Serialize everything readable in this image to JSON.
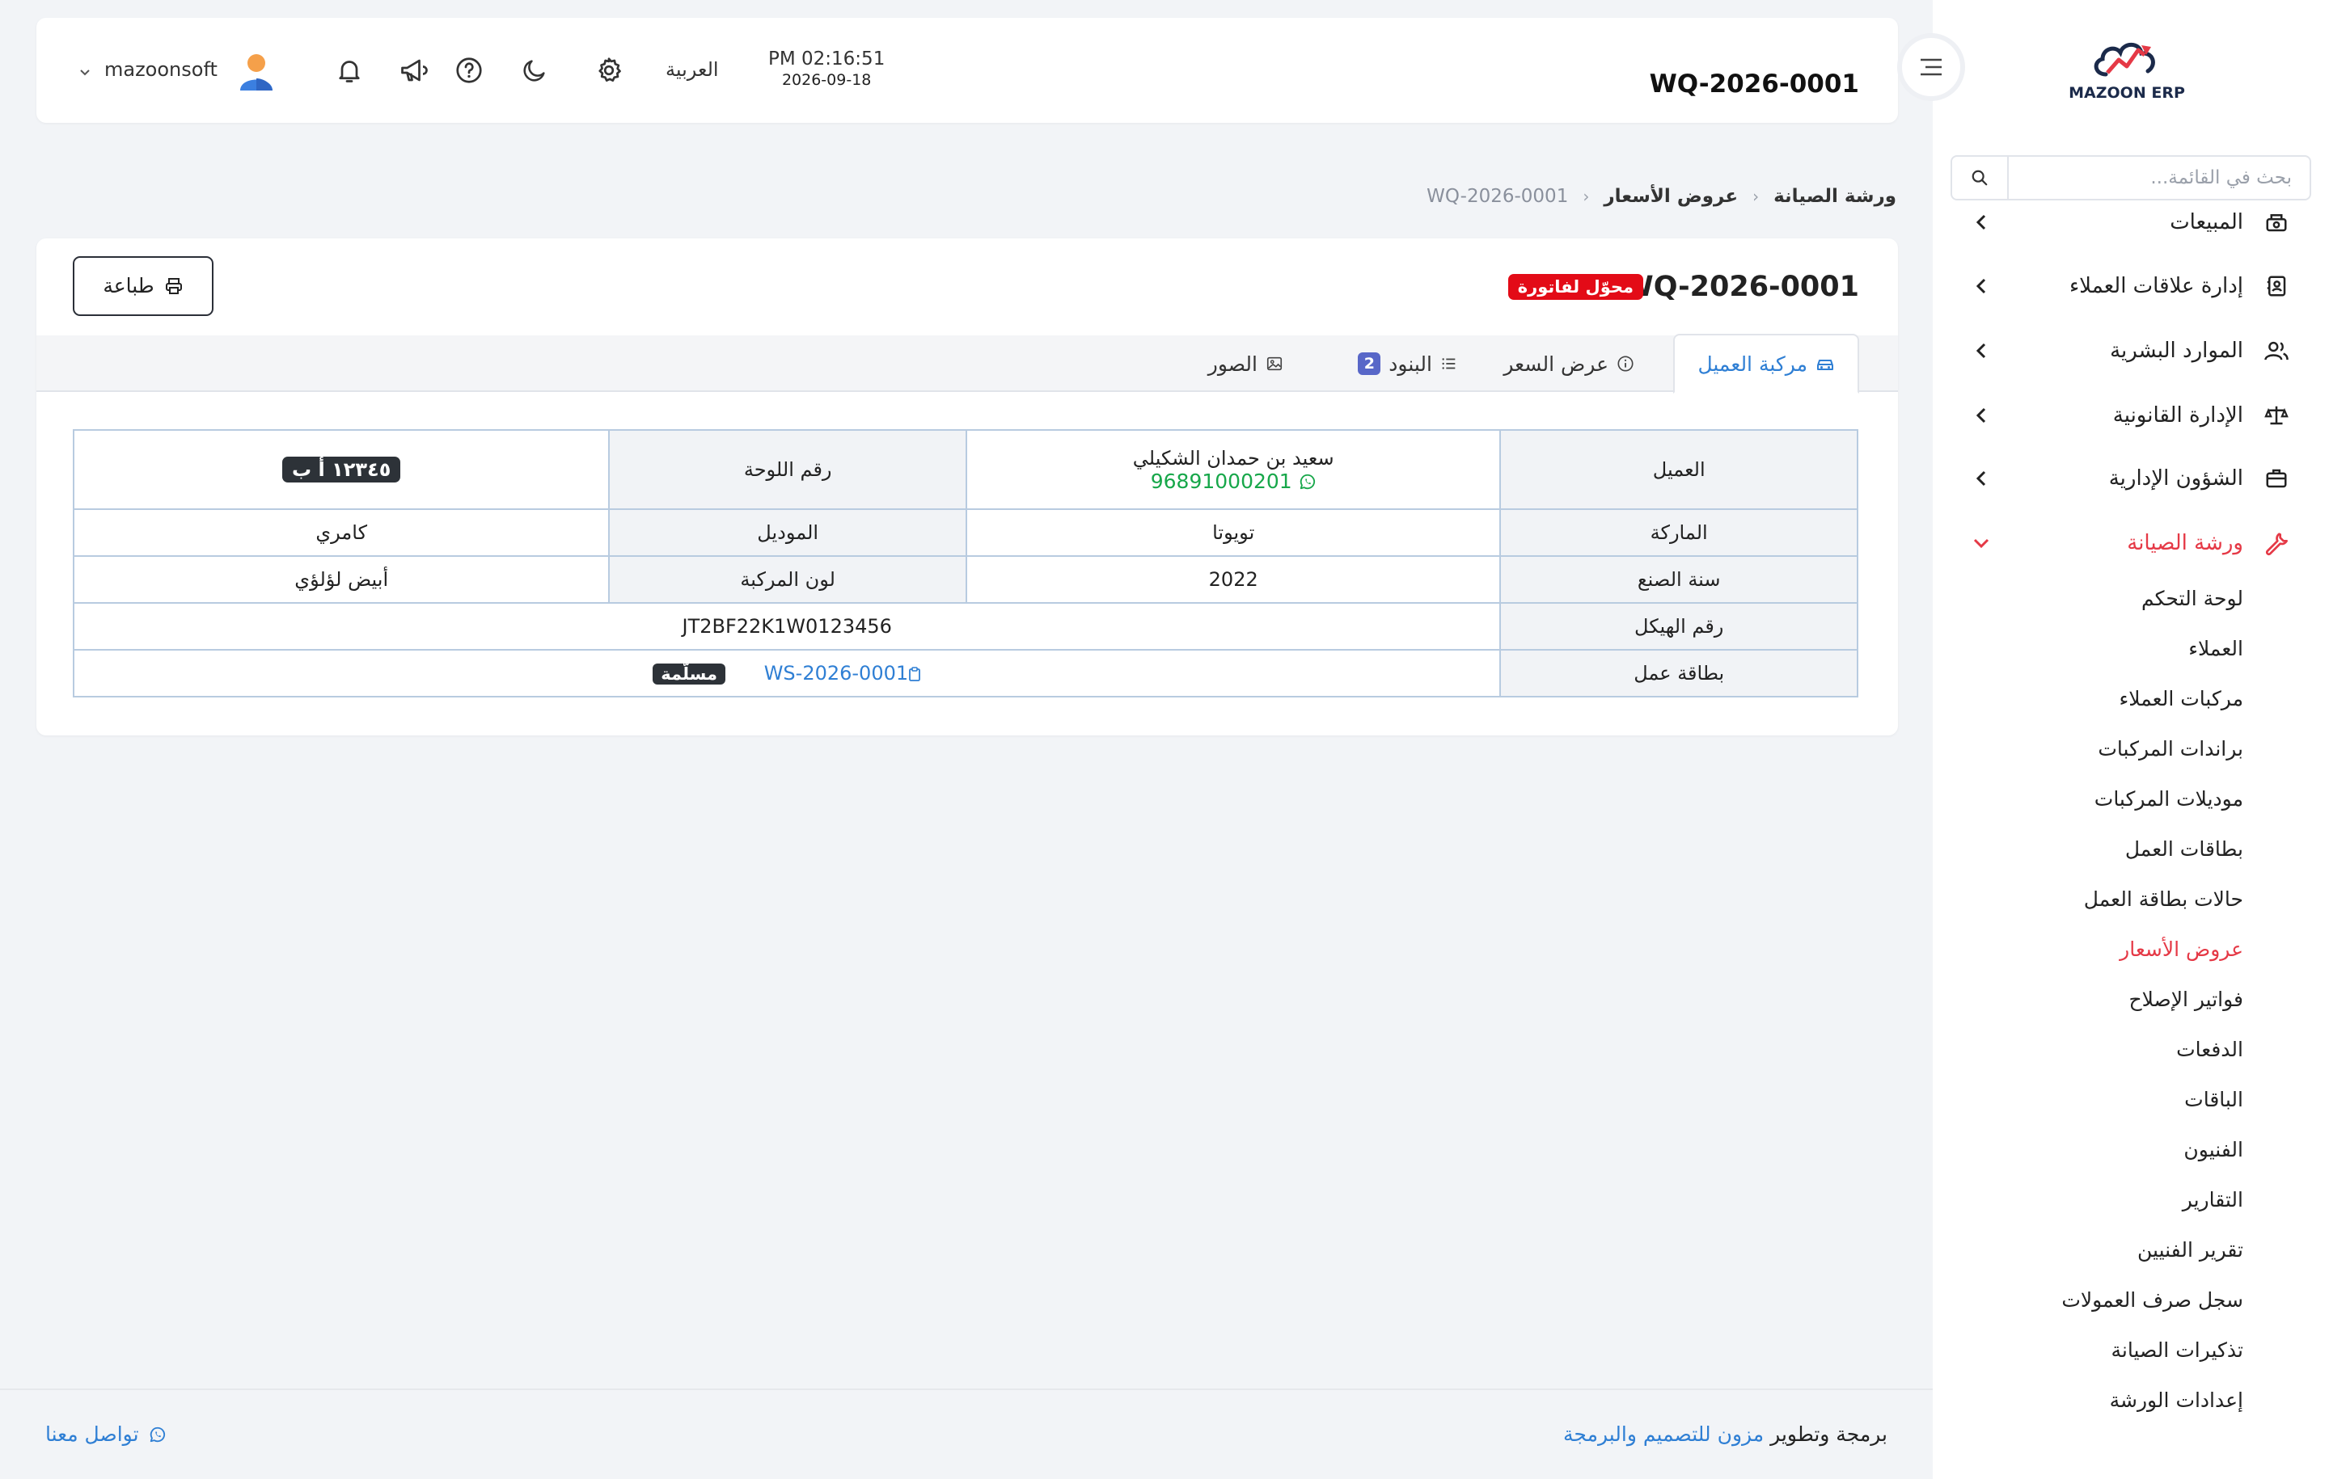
{
  "sidebar": {
    "logo_text": "MAZOON ERP",
    "search_placeholder": "بحث في القائمة...",
    "items": [
      {
        "label": "المبيعات",
        "icon": "cash-register-icon"
      },
      {
        "label": "إدارة علاقات العملاء",
        "icon": "address-book-icon"
      },
      {
        "label": "الموارد البشرية",
        "icon": "users-icon"
      },
      {
        "label": "الإدارة القانونية",
        "icon": "scale-icon"
      },
      {
        "label": "الشؤون الإدارية",
        "icon": "briefcase-icon"
      },
      {
        "label": "ورشة الصيانة",
        "icon": "wrench-icon",
        "active": true
      }
    ],
    "sub_items": [
      "لوحة التحكم",
      "العملاء",
      "مركبات العملاء",
      "براندات المركبات",
      "موديلات المركبات",
      "بطاقات العمل",
      "حالات بطاقة العمل",
      "عروض الأسعار",
      "فواتير الإصلاح",
      "الدفعات",
      "الباقات",
      "الفنيون",
      "التقارير",
      "تقرير الفنيين",
      "سجل صرف العمولات",
      "تذكيرات الصيانة",
      "إعدادات الورشة"
    ],
    "active_sub": "عروض الأسعار",
    "accent_color": "#e53946"
  },
  "header": {
    "doc_id": "WQ-2026-0001",
    "time": "PM 02:16:51",
    "date": "2026-09-18",
    "language": "العربية",
    "username": "mazoonsoft"
  },
  "breadcrumb": {
    "section": "ورشة الصيانة",
    "page": "عروض الأسعار",
    "current": "WQ-2026-0001"
  },
  "card": {
    "title": "WQ-2026-0001",
    "status": "محوّل لفاتورة",
    "status_color": "#e30b17",
    "print_label": "طباعة",
    "tabs": [
      {
        "label": "مركبة العميل",
        "icon": "car-icon",
        "active": true
      },
      {
        "label": "عرض السعر",
        "icon": "info-icon"
      },
      {
        "label": "البنود",
        "icon": "list-icon",
        "badge": "2"
      },
      {
        "label": "الصور",
        "icon": "image-icon"
      }
    ]
  },
  "vehicle": {
    "customer_label": "العميل",
    "customer_name": "سعيد بن حمدان الشكيلي",
    "customer_phone": "96891000201",
    "plate_label": "رقم اللوحة",
    "plate_value": "١٢٣٤٥ أ ب",
    "brand_label": "الماركة",
    "brand_value": "تويوتا",
    "model_label": "الموديل",
    "model_value": "كامري",
    "year_label": "سنة الصنع",
    "year_value": "2022",
    "color_label": "لون المركبة",
    "color_value": "أبيض لؤلؤي",
    "vin_label": "رقم الهيكل",
    "vin_value": "JT2BF22K1W0123456",
    "jobcard_label": "بطاقة عمل",
    "jobcard_value": "WS-2026-0001",
    "jobcard_status": "مسلّمة"
  },
  "footer": {
    "dev_prefix": "برمجة وتطوير",
    "dev_brand": "مزون للتصميم والبرمجة",
    "contact": "تواصل معنا"
  }
}
